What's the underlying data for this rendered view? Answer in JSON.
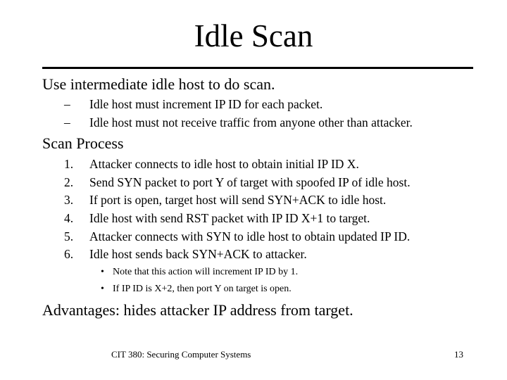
{
  "slide": {
    "title": "Idle Scan",
    "sections": [
      {
        "heading": "Use intermediate idle host to do scan.",
        "items": [
          {
            "marker": "–",
            "text": "Idle host must increment IP ID for each packet."
          },
          {
            "marker": "–",
            "text": "Idle host must not receive traffic from anyone other than attacker."
          }
        ]
      },
      {
        "heading": "Scan Process",
        "items": [
          {
            "marker": "1.",
            "text": "Attacker connects to idle host to obtain initial IP ID X."
          },
          {
            "marker": "2.",
            "text": "Send SYN packet to port Y of target with spoofed IP of idle host."
          },
          {
            "marker": "3.",
            "text": "If port is open, target host will send SYN+ACK to idle host."
          },
          {
            "marker": "4.",
            "text": "Idle host with send RST packet with IP ID X+1 to target."
          },
          {
            "marker": "5.",
            "text": "Attacker connects with SYN to idle host to obtain updated IP ID."
          },
          {
            "marker": "6.",
            "text": "Idle host sends back SYN+ACK to attacker."
          }
        ],
        "subitems": [
          {
            "marker": "•",
            "text": "Note that this action will increment IP ID by 1."
          },
          {
            "marker": "•",
            "text": "If IP ID is X+2, then port Y on target is open."
          }
        ]
      },
      {
        "heading": "Advantages: hides attacker IP address from target."
      }
    ],
    "footer": {
      "course": "CIT 380: Securing Computer Systems",
      "page_number": "13"
    }
  }
}
